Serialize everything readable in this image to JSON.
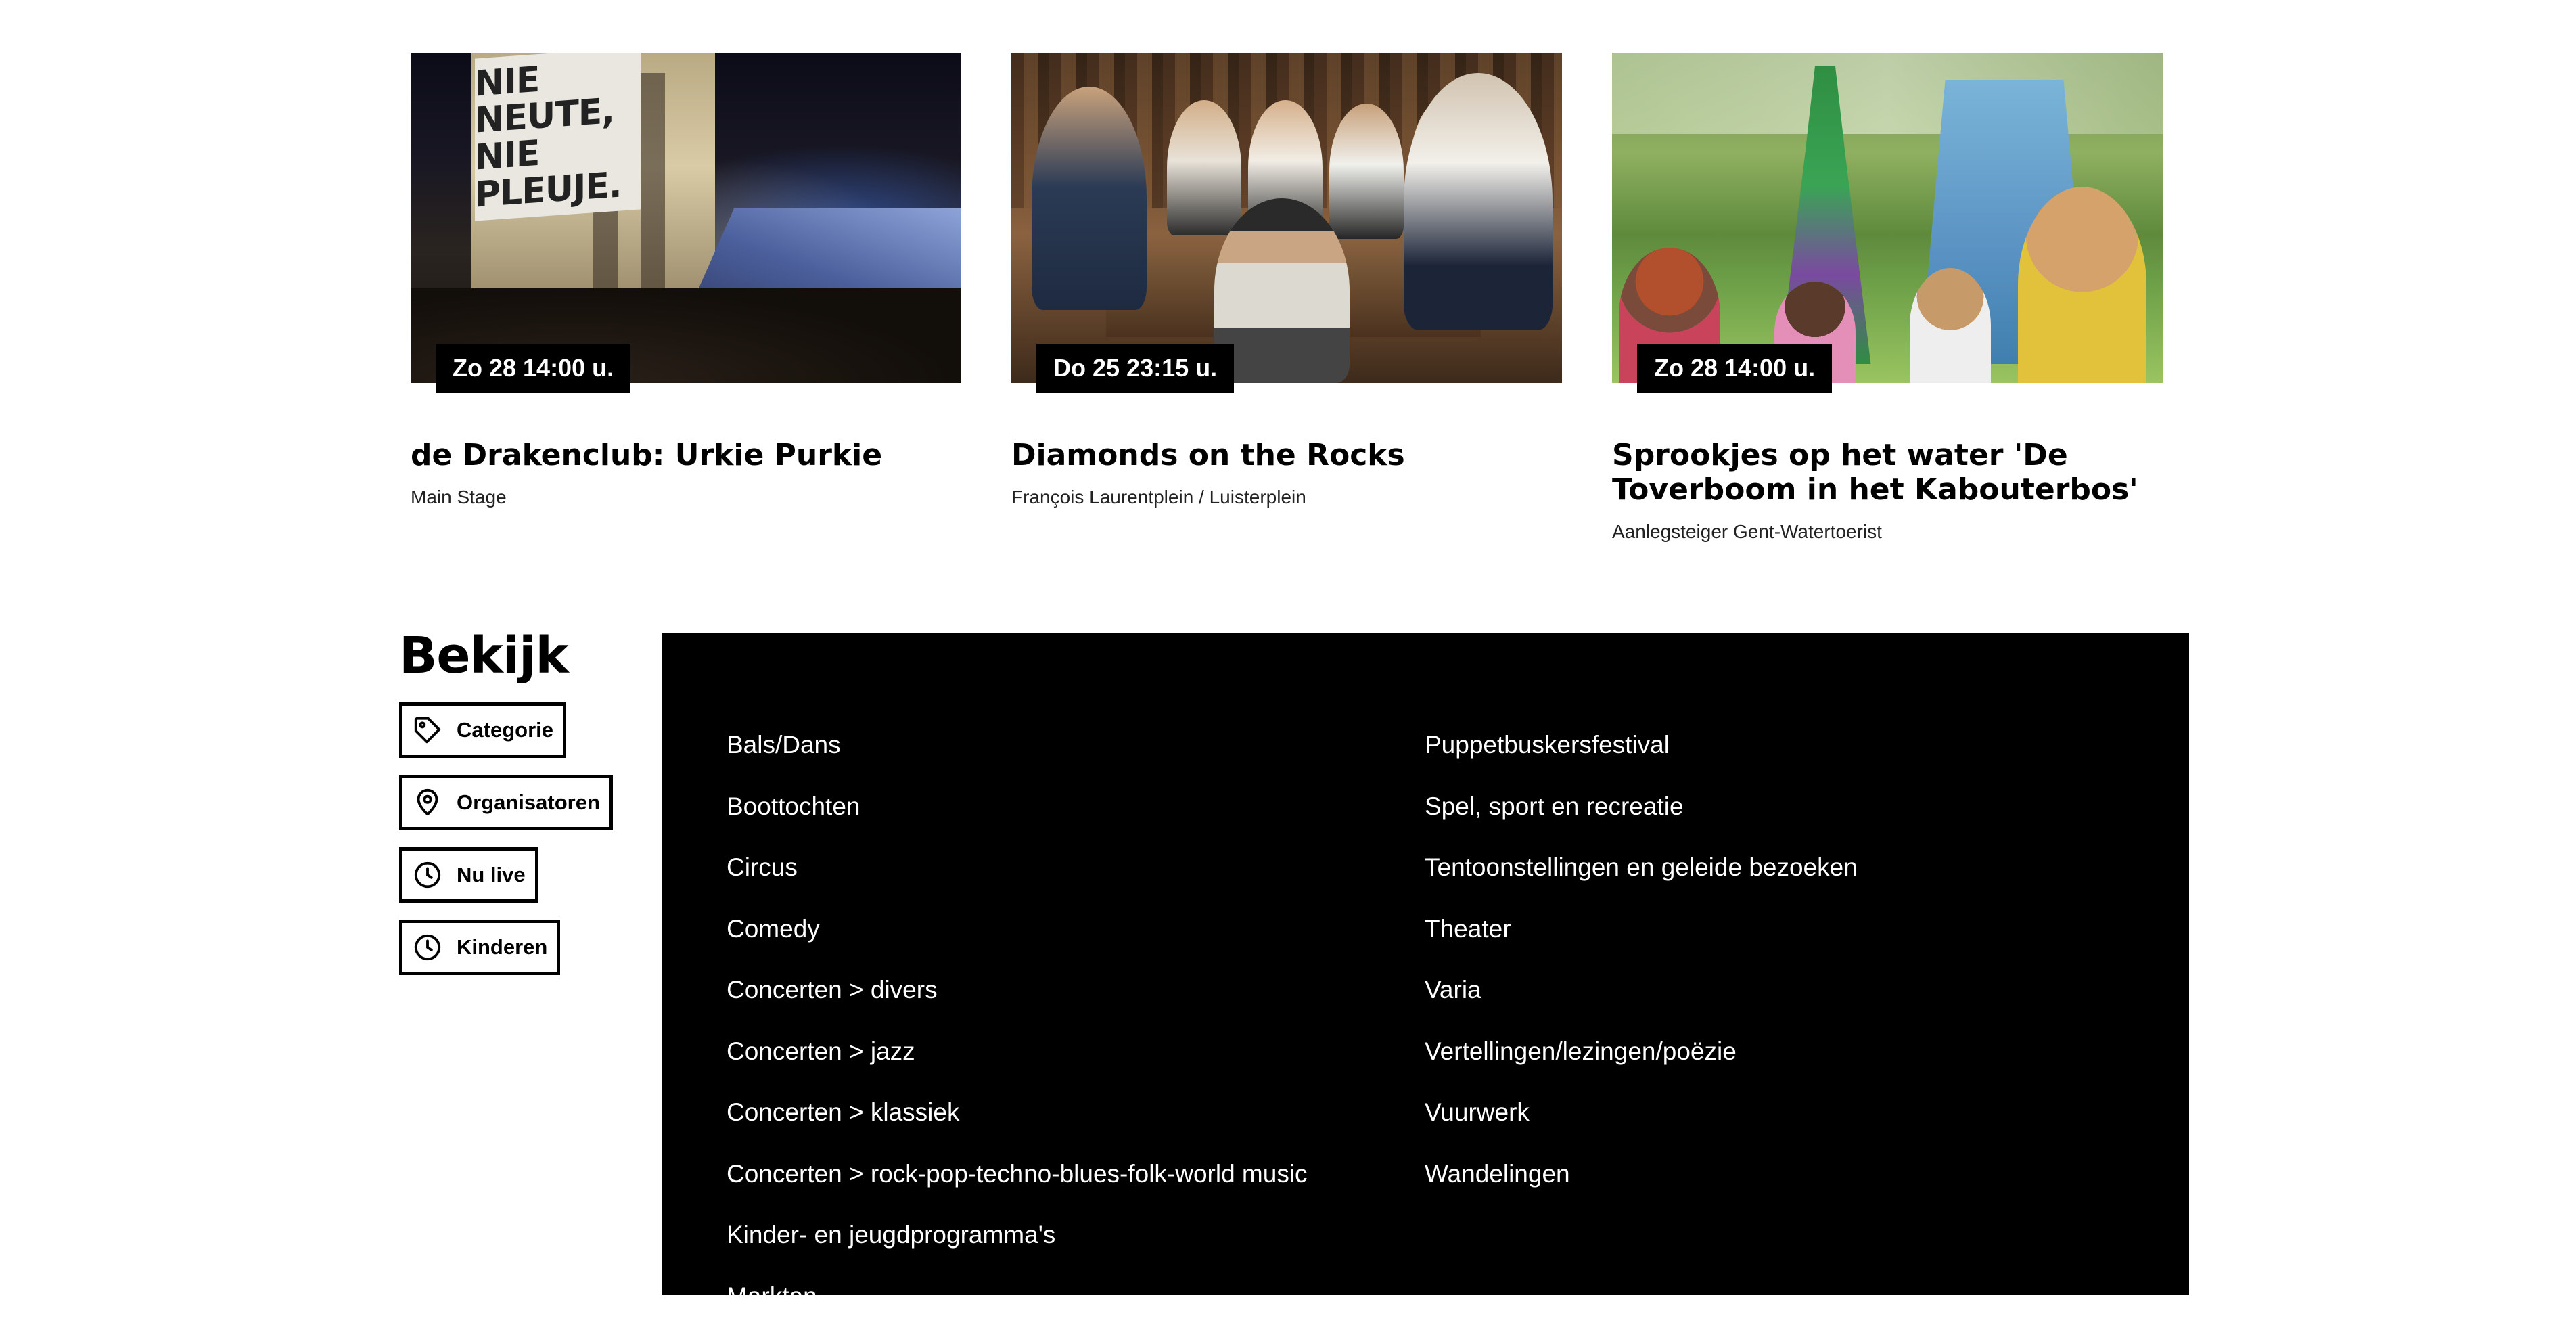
{
  "events": [
    {
      "date": "Zo 28 14:00 u.",
      "title": "de Drakenclub: Urkie Purkie",
      "location": "Main Stage",
      "image_banner": [
        "NIE NEUTE,",
        "NIE PLEUJE."
      ]
    },
    {
      "date": "Do 25 23:15 u.",
      "title": "Diamonds on the Rocks",
      "location": "François Laurentplein / Luisterplein"
    },
    {
      "date": "Zo 28 14:00 u.",
      "title": "Sprookjes op het water 'De Toverboom in het Kabouterbos'",
      "location": "Aanlegsteiger Gent-Watertoerist"
    }
  ],
  "bekijk": {
    "title": "Bekijk",
    "filters": [
      {
        "label": "Categorie",
        "icon": "tag-icon"
      },
      {
        "label": "Organisatoren",
        "icon": "location-pin-icon"
      },
      {
        "label": "Nu live",
        "icon": "clock-icon"
      },
      {
        "label": "Kinderen",
        "icon": "clock-icon"
      }
    ]
  },
  "categories": {
    "left": [
      "Bals/Dans",
      "Boottochten",
      "Circus",
      "Comedy",
      "Concerten > divers",
      "Concerten > jazz",
      "Concerten > klassiek",
      "Concerten > rock-pop-techno-blues-folk-world music",
      "Kinder- en jeugdprogramma's",
      "Markten"
    ],
    "right": [
      "Puppetbuskersfestival",
      "Spel, sport en recreatie",
      "Tentoonstellingen en geleide bezoeken",
      "Theater",
      "Varia",
      "Vertellingen/lezingen/poëzie",
      "Vuurwerk",
      "Wandelingen"
    ]
  },
  "colors": {
    "panel_background": "#000000",
    "page_background": "#ffffff",
    "text": "#000000"
  }
}
